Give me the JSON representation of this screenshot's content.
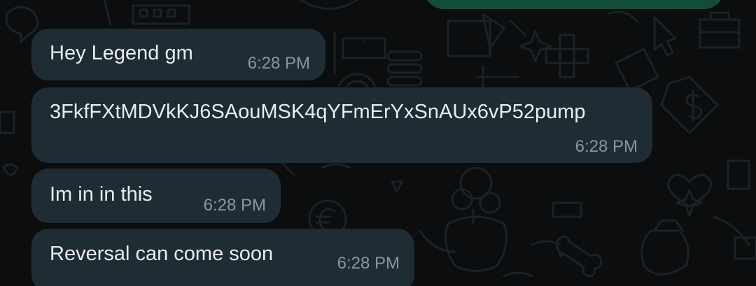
{
  "conversation": {
    "messages": [
      {
        "text": "Hey Legend gm",
        "time": "6:28 PM",
        "direction": "incoming"
      },
      {
        "text": "3FkfFXtMDVkKJ6SAouMSK4qYFmErYxSnAUx6vP52pump",
        "time": "6:28 PM",
        "direction": "incoming"
      },
      {
        "text": "Im in in this",
        "time": "6:28 PM",
        "direction": "incoming"
      },
      {
        "text": "Reversal can come soon",
        "time": "6:28 PM",
        "direction": "incoming"
      }
    ]
  },
  "colors": {
    "background": "#0b0d0e",
    "incoming_bubble": "#202c33",
    "outgoing_bubble": "#144d37",
    "message_text": "#e9edef",
    "timestamp_text": "#8696a0",
    "wallpaper_doodle": "#1c2124"
  },
  "wallpaper": {
    "icons": [
      "briefcase-icon",
      "dollar-tag-icon",
      "heart-icon",
      "sparkle-icon",
      "euro-coin-icon",
      "poodle-icon",
      "bone-icon",
      "money-bag-icon",
      "cursor-icon",
      "chat-bubble-icon"
    ]
  }
}
